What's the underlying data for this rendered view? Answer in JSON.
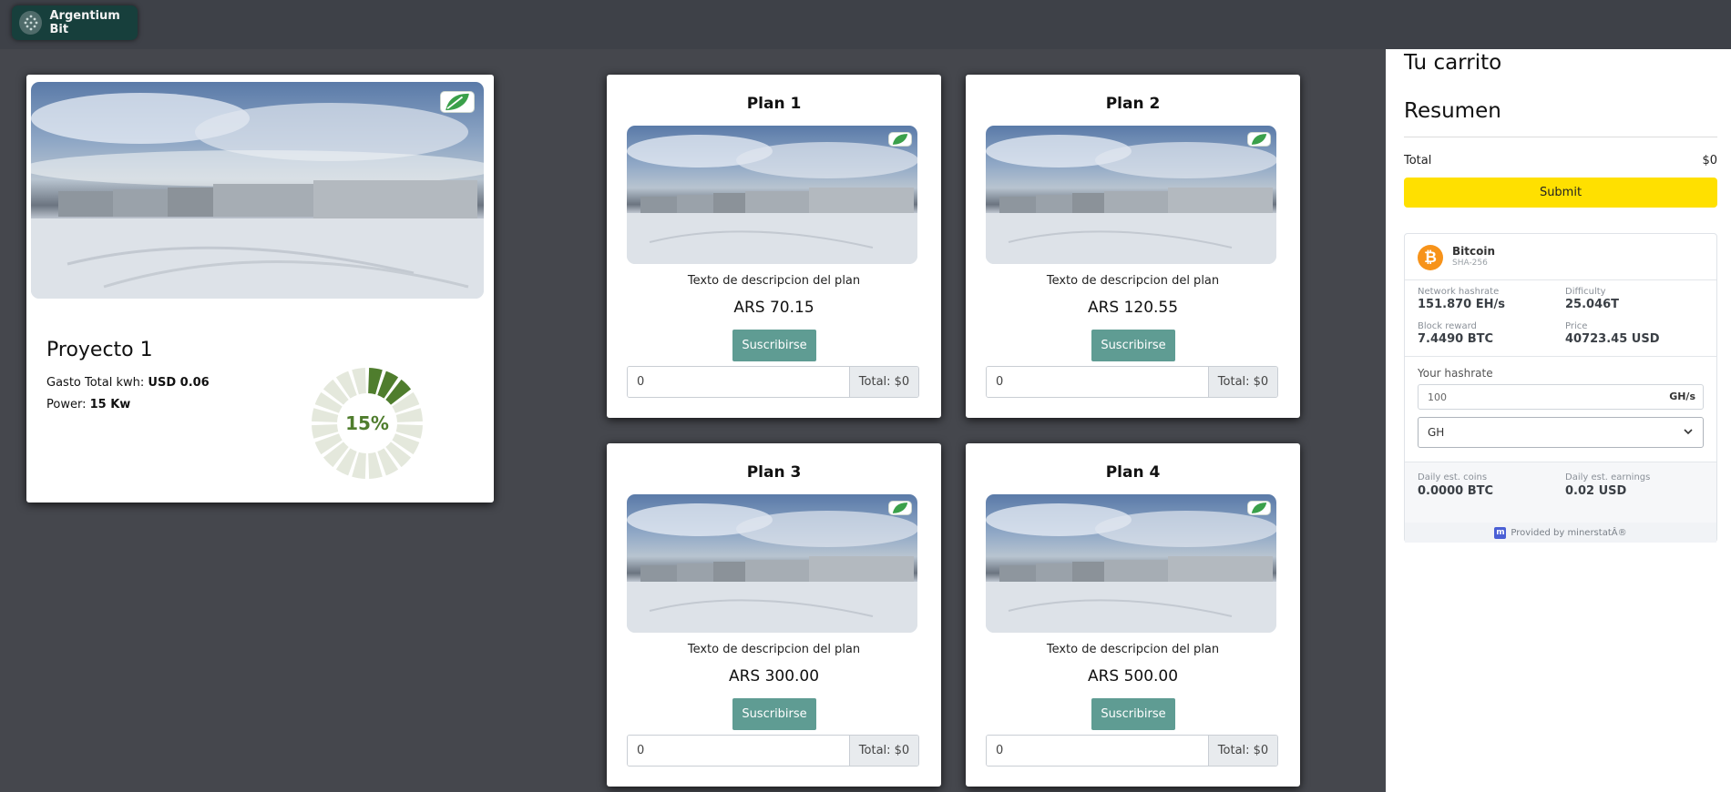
{
  "brand": {
    "name": "Argentium Bit"
  },
  "project": {
    "title": "Proyecto 1",
    "kwh_label": "Gasto Total kwh:",
    "kwh_value": "USD 0.06",
    "power_label": "Power:",
    "power_value": "15 Kw",
    "progress_percent": 15,
    "progress_text": "15%"
  },
  "plans": [
    {
      "title": "Plan 1",
      "description": "Texto de descripcion del plan",
      "price": "ARS 70.15",
      "button": "Suscribirse",
      "quantity": "0",
      "total": "Total: $0"
    },
    {
      "title": "Plan 2",
      "description": "Texto de descripcion del plan",
      "price": "ARS 120.55",
      "button": "Suscribirse",
      "quantity": "0",
      "total": "Total: $0"
    },
    {
      "title": "Plan 3",
      "description": "Texto de descripcion del plan",
      "price": "ARS 300.00",
      "button": "Suscribirse",
      "quantity": "0",
      "total": "Total: $0"
    },
    {
      "title": "Plan 4",
      "description": "Texto de descripcion del plan",
      "price": "ARS 500.00",
      "button": "Suscribirse",
      "quantity": "0",
      "total": "Total: $0"
    }
  ],
  "cart": {
    "title": "Tu carrito",
    "summary_title": "Resumen",
    "total_label": "Total",
    "total_value": "$0",
    "submit_label": "Submit"
  },
  "calculator": {
    "coin_symbol": "₿",
    "coin_name": "Bitcoin",
    "algorithm": "SHA-256",
    "network_hashrate_label": "Network hashrate",
    "network_hashrate": "151.870 EH/s",
    "difficulty_label": "Difficulty",
    "difficulty": "25.046T",
    "block_reward_label": "Block reward",
    "block_reward": "7.4490 BTC",
    "price_label": "Price",
    "price": "40723.45 USD",
    "your_hashrate_label": "Your hashrate",
    "hashrate_value": "100",
    "hashrate_unit": "GH/s",
    "unit_selected": "GH",
    "daily_coins_label": "Daily est. coins",
    "daily_coins": "0.0000 BTC",
    "daily_earnings_label": "Daily est. earnings",
    "daily_earnings": "0.02 USD",
    "provider_icon": "m",
    "provider": "Provided by minerstatÂ®"
  },
  "colors": {
    "background": "#45474d",
    "accent_button": "#5f9c93",
    "submit_button": "#ffe000",
    "progress_fill": "#4f7d2d",
    "progress_empty": "#e4e8dc",
    "bitcoin": "#f7931a"
  }
}
